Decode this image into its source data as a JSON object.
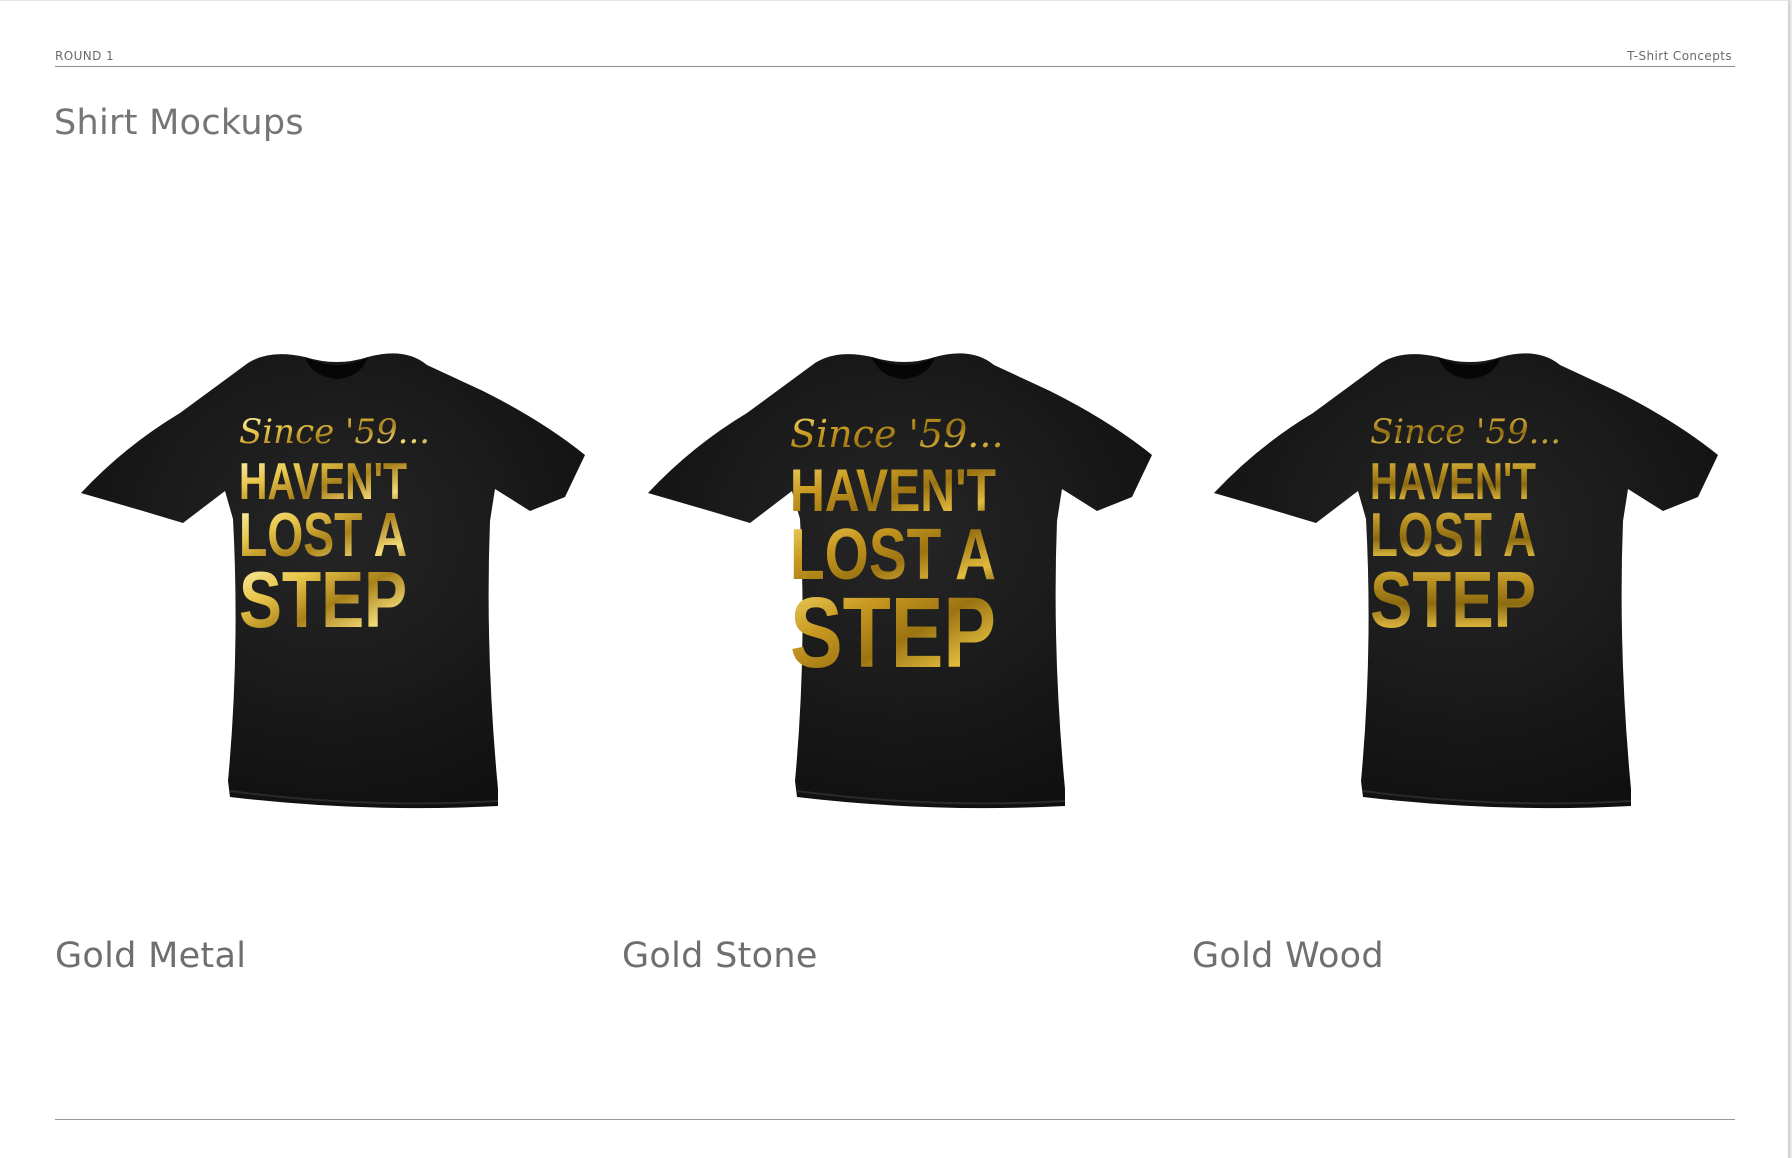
{
  "header": {
    "left_label": "ROUND 1",
    "right_label": "T-Shirt Concepts"
  },
  "page": {
    "title": "Shirt Mockups"
  },
  "mockups": [
    {
      "caption": "Gold Metal",
      "print": {
        "line1": "Since '59...",
        "line2": "HAVEN'T",
        "line3": "LOST A",
        "line4": "STEP"
      },
      "colors": [
        "#fff6c0",
        "#e8c64a",
        "#a8801a",
        "#f4dc78",
        "#8a6410"
      ]
    },
    {
      "caption": "Gold Stone",
      "print": {
        "line1": "Since '59...",
        "line2": "HAVEN'T",
        "line3": "LOST A",
        "line4": "STEP"
      },
      "colors": [
        "#f3d86a",
        "#c99a22",
        "#9b7412",
        "#e2bb3e",
        "#6e500a"
      ]
    },
    {
      "caption": "Gold Wood",
      "print": {
        "line1": "Since '59...",
        "line2": "HAVEN'T",
        "line3": "LOST A",
        "line4": "STEP"
      },
      "colors": [
        "#e6c454",
        "#b89020",
        "#8c6a10",
        "#d6b23c",
        "#5e4408"
      ]
    }
  ],
  "colors": {
    "shirt": "#1a1a1a",
    "shirt_shadow": "#0b0b0b",
    "text_gray": "#757575",
    "rule": "#8a8a8a"
  }
}
